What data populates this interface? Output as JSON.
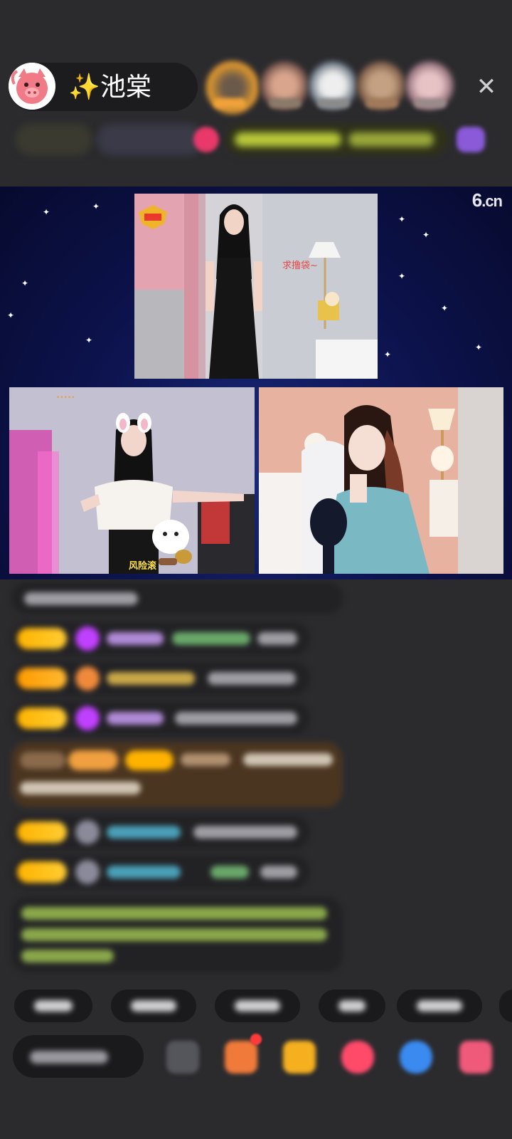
{
  "header": {
    "host_prefix": "✨",
    "host_name": "池棠",
    "close_icon": "✕"
  },
  "stage": {
    "logo_main": "6",
    "logo_suffix": ".cn",
    "top_tile_overlay": "求撸袋~",
    "left_tile_caption": "风险滚"
  },
  "colors": {
    "background": "#2b2b2e",
    "stage_bg": "#0d1450",
    "level_badge": "#ffb300",
    "gem_purple": "#c040ff",
    "highlight_message": "#5a3a1e"
  },
  "icons": {
    "close": "close-icon",
    "host_avatar": "pig-avatar-icon",
    "gift": "gift-icon",
    "game": "gamepad-icon",
    "more": "grid-icon",
    "emoji": "emoji-icon",
    "treasure": "treasure-icon"
  }
}
